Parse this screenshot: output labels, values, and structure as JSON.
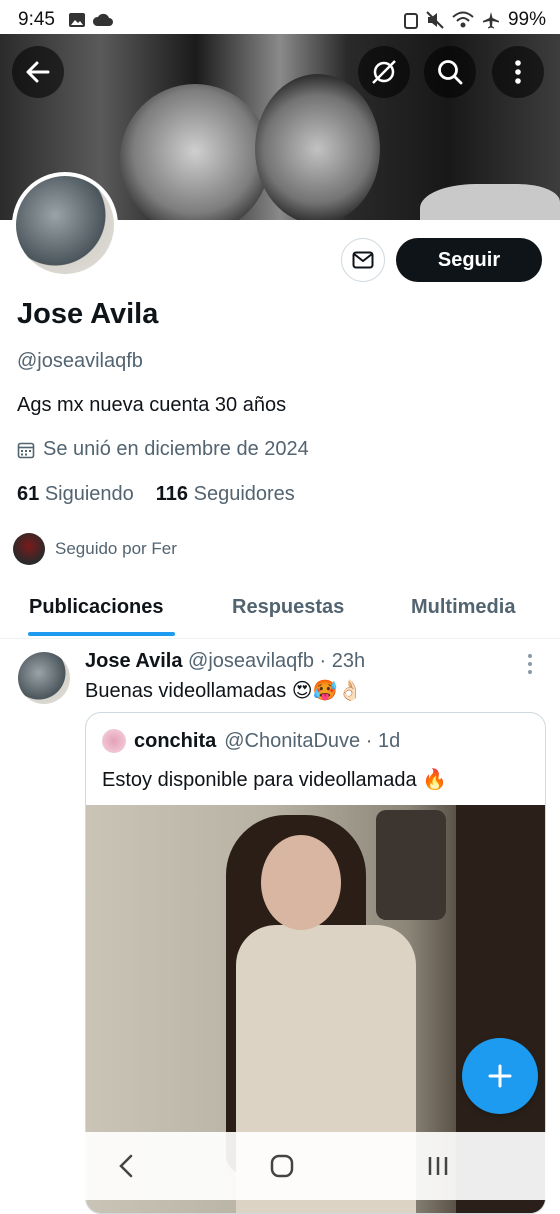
{
  "status_bar": {
    "time": "9:45",
    "battery": "99%"
  },
  "profile": {
    "name": "Jose Avila",
    "handle": "@joseavilaqfb",
    "bio": "Ags mx nueva cuenta  30 años",
    "joined": "Se unió en diciembre de 2024",
    "following_count": "61",
    "following_label": "Siguiendo",
    "followers_count": "116",
    "followers_label": "Seguidores",
    "followed_by": "Seguido por Fer",
    "follow_button": "Seguir"
  },
  "tabs": [
    {
      "label": "Publicaciones",
      "active": true
    },
    {
      "label": "Respuestas",
      "active": false
    },
    {
      "label": "Multimedia",
      "active": false
    }
  ],
  "post": {
    "author": "Jose Avila",
    "meta": "@joseavilaqfb · 23h",
    "text": "Buenas videollamadas 😍🥵👌🏻",
    "quote": {
      "author": "conchita",
      "meta": "@ChonitaDuve · 1d",
      "text": "Estoy disponible para videollamada 🔥"
    }
  },
  "colors": {
    "accent": "#1d9bf0",
    "text": "#0f1419",
    "muted": "#536471"
  }
}
